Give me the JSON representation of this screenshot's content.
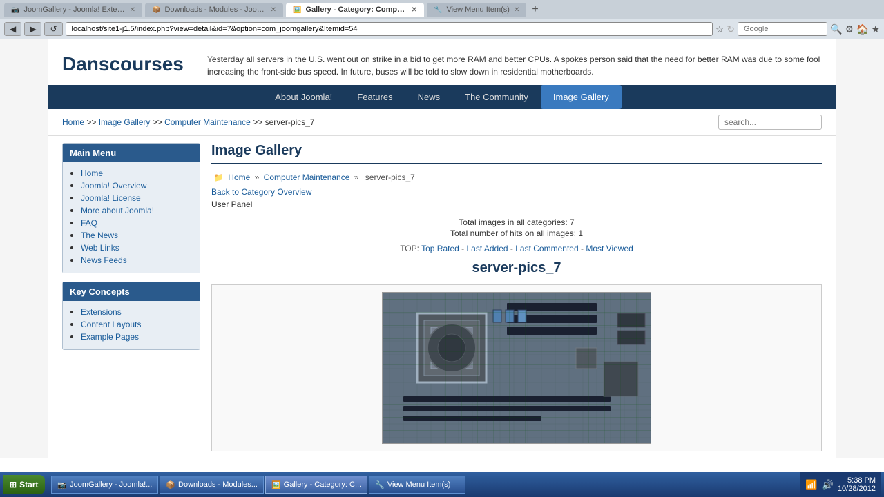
{
  "browser": {
    "tabs": [
      {
        "id": "tab1",
        "label": "JoomGallery - Joomla! Extensions Directory",
        "active": false
      },
      {
        "id": "tab2",
        "label": "Downloads - Modules - JoomImages",
        "active": false
      },
      {
        "id": "tab3",
        "label": "Gallery - Category: Computer Maintenan...",
        "active": true
      },
      {
        "id": "tab4",
        "label": "View Menu Item(s)",
        "active": false
      }
    ],
    "address": "localhost/site1-j1.5/index.php?view=detail&id=7&option=com_joomgallery&Itemid=54",
    "search_placeholder": "Google"
  },
  "site": {
    "logo": "Danscourses",
    "header_news": "Yesterday all servers in the U.S. went out on strike in a bid to get more RAM and better CPUs. A spokes person said that the need for better RAM was due to some fool increasing the front-side bus speed. In future, buses will be told to slow down in residential motherboards."
  },
  "nav": {
    "items": [
      {
        "id": "about",
        "label": "About Joomla!",
        "active": false
      },
      {
        "id": "features",
        "label": "Features",
        "active": false
      },
      {
        "id": "news",
        "label": "News",
        "active": false
      },
      {
        "id": "community",
        "label": "The Community",
        "active": false
      },
      {
        "id": "gallery",
        "label": "Image Gallery",
        "active": true
      }
    ]
  },
  "breadcrumb": {
    "items": [
      "Home",
      "Image Gallery",
      "Computer Maintenance",
      "server-pics_7"
    ],
    "separators": [
      ">>",
      ">>",
      ">>"
    ]
  },
  "search": {
    "placeholder": "search..."
  },
  "sidebar": {
    "main_menu": {
      "title": "Main Menu",
      "items": [
        {
          "label": "Home",
          "href": "#"
        },
        {
          "label": "Joomla! Overview",
          "href": "#"
        },
        {
          "label": "Joomla! License",
          "href": "#"
        },
        {
          "label": "More about Joomla!",
          "href": "#"
        },
        {
          "label": "FAQ",
          "href": "#"
        },
        {
          "label": "The News",
          "href": "#"
        },
        {
          "label": "Web Links",
          "href": "#"
        },
        {
          "label": "News Feeds",
          "href": "#"
        }
      ]
    },
    "key_concepts": {
      "title": "Key Concepts",
      "items": [
        {
          "label": "Extensions",
          "href": "#"
        },
        {
          "label": "Content Layouts",
          "href": "#"
        },
        {
          "label": "Example Pages",
          "href": "#"
        }
      ]
    }
  },
  "content": {
    "title": "Image Gallery",
    "breadcrumb_trail": {
      "home": "Home",
      "category": "Computer Maintenance",
      "current": "server-pics_7"
    },
    "back_link": "Back to Category Overview",
    "user_panel": "User Panel",
    "stats": {
      "total_images": "Total images in all categories: 7",
      "total_hits": "Total number of hits on all images: 1"
    },
    "top_label": "TOP:",
    "top_links": [
      "Top Rated",
      "Last Added",
      "Last Commented",
      "Most Viewed"
    ],
    "top_seps": [
      " - ",
      " - ",
      " - "
    ],
    "category_name": "server-pics_7"
  },
  "taskbar": {
    "start_label": "Start",
    "items": [
      "JoomGallery - Joomla!...",
      "Downloads - Modules...",
      "Gallery - Category: C...",
      "View Menu Item(s)"
    ],
    "time": "5:38 PM",
    "date": "10/28/2012"
  }
}
